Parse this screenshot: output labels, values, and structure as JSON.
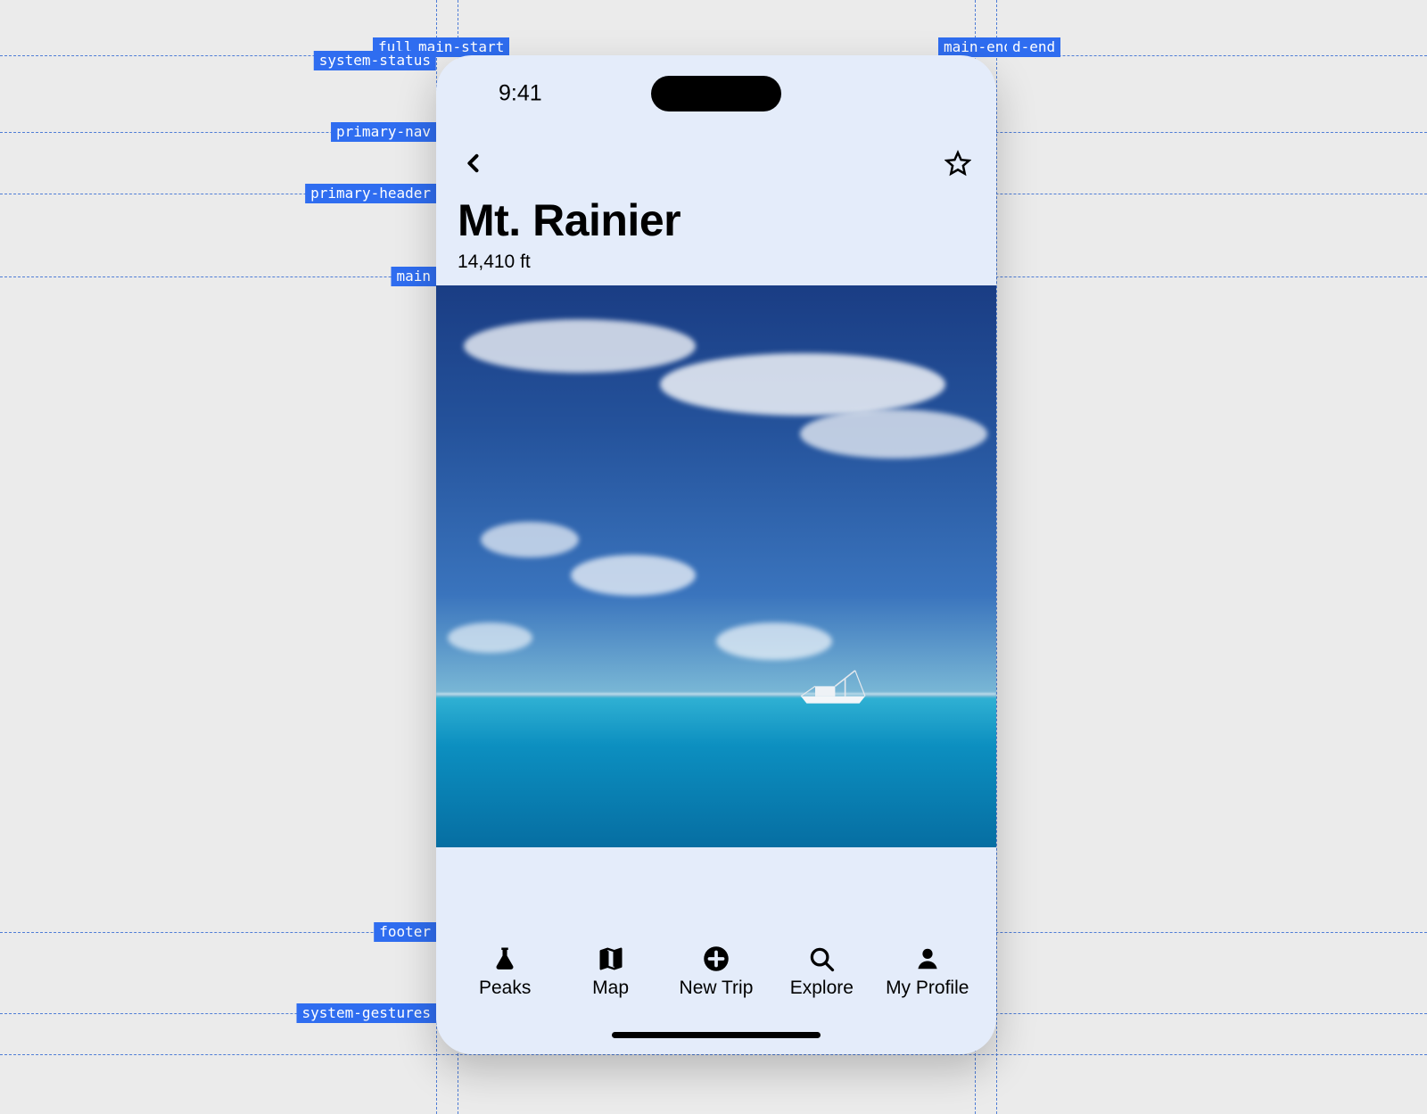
{
  "status": {
    "time": "9:41"
  },
  "header": {
    "title": "Mt. Rainier",
    "subtitle": "14,410 ft"
  },
  "tabs": [
    {
      "label": "Peaks"
    },
    {
      "label": "Map"
    },
    {
      "label": "New Trip"
    },
    {
      "label": "Explore"
    },
    {
      "label": "My Profile"
    }
  ],
  "guides": {
    "v_labels": {
      "fullb": "fullb",
      "main_start": "main-start",
      "main_end": "main-end",
      "d_end": "d-end"
    },
    "h_labels": {
      "system_status": "system-status",
      "primary_nav": "primary-nav",
      "primary_header": "primary-header",
      "main": "main",
      "footer": "footer",
      "system_gestures": "system-gestures"
    }
  }
}
